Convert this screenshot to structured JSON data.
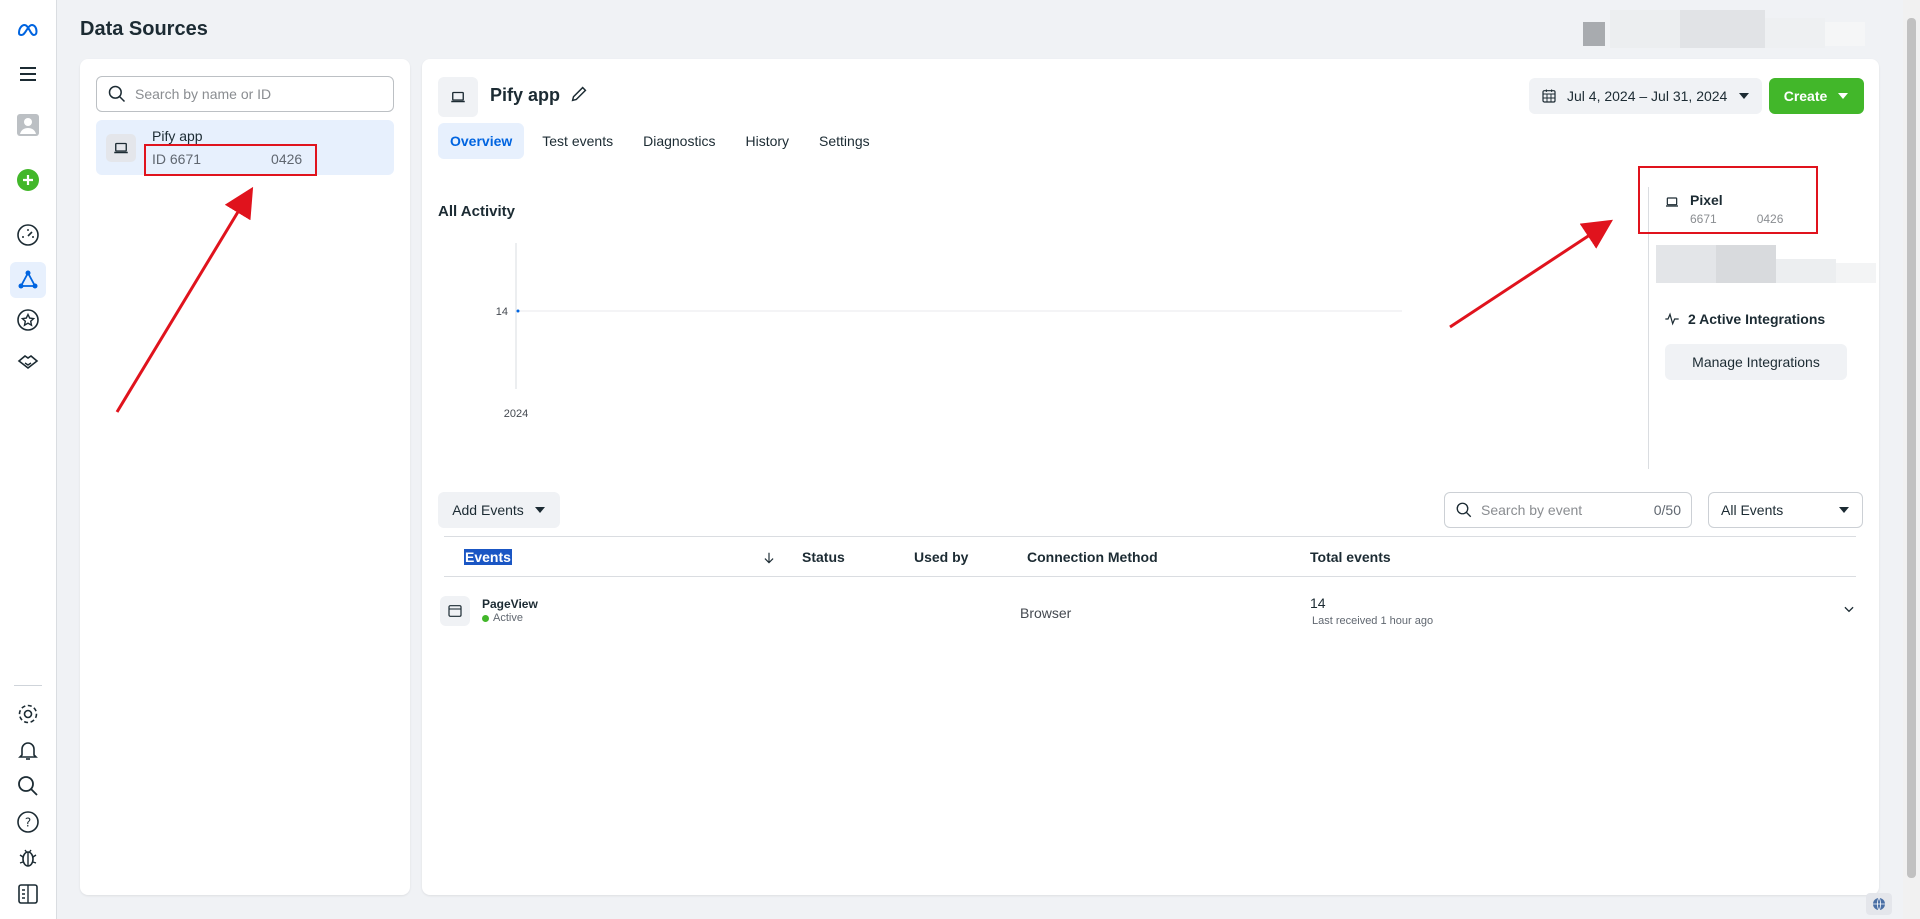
{
  "page": {
    "title": "Data Sources"
  },
  "rail": {
    "icons": [
      "meta-logo-icon",
      "menu-icon",
      "avatar-icon",
      "add-icon",
      "dashboard-icon",
      "data-sources-icon",
      "star-icon",
      "partnerships-icon",
      "settings-icon",
      "notifications-icon",
      "search-icon",
      "help-icon",
      "bug-icon",
      "panel-toggle-icon"
    ],
    "accent": "#0064e0",
    "add_color": "#42b72a"
  },
  "left_panel": {
    "search_placeholder": "Search by name or ID",
    "source": {
      "name": "Pify app",
      "id_prefix": "ID 6671",
      "id_suffix": "0426"
    }
  },
  "main": {
    "app_title": "Pify app",
    "date_range": "Jul 4, 2024 – Jul 31, 2024",
    "create_label": "Create",
    "tabs": [
      {
        "label": "Overview",
        "active": true
      },
      {
        "label": "Test events",
        "active": false
      },
      {
        "label": "Diagnostics",
        "active": false
      },
      {
        "label": "History",
        "active": false
      },
      {
        "label": "Settings",
        "active": false
      }
    ],
    "activity_title": "All Activity",
    "side": {
      "pixel_label": "Pixel",
      "pixel_id_prefix": "6671",
      "pixel_id_suffix": "0426",
      "integrations": "2 Active Integrations",
      "manage_label": "Manage Integrations"
    },
    "add_events_label": "Add Events",
    "event_search_placeholder": "Search by event",
    "event_search_count": "0/50",
    "filter_value": "All Events",
    "table": {
      "columns": [
        "Events",
        "Status",
        "Used by",
        "Connection Method",
        "Total events"
      ],
      "rows": [
        {
          "event": "PageView",
          "status": "Active",
          "connection": "Browser",
          "total": "14",
          "last_received": "Last received 1 hour ago"
        }
      ]
    }
  },
  "chart_data": {
    "type": "line",
    "x": [
      "2024"
    ],
    "series": [
      {
        "values": [
          14
        ]
      }
    ],
    "ytick": "14",
    "xtick": "2024"
  }
}
